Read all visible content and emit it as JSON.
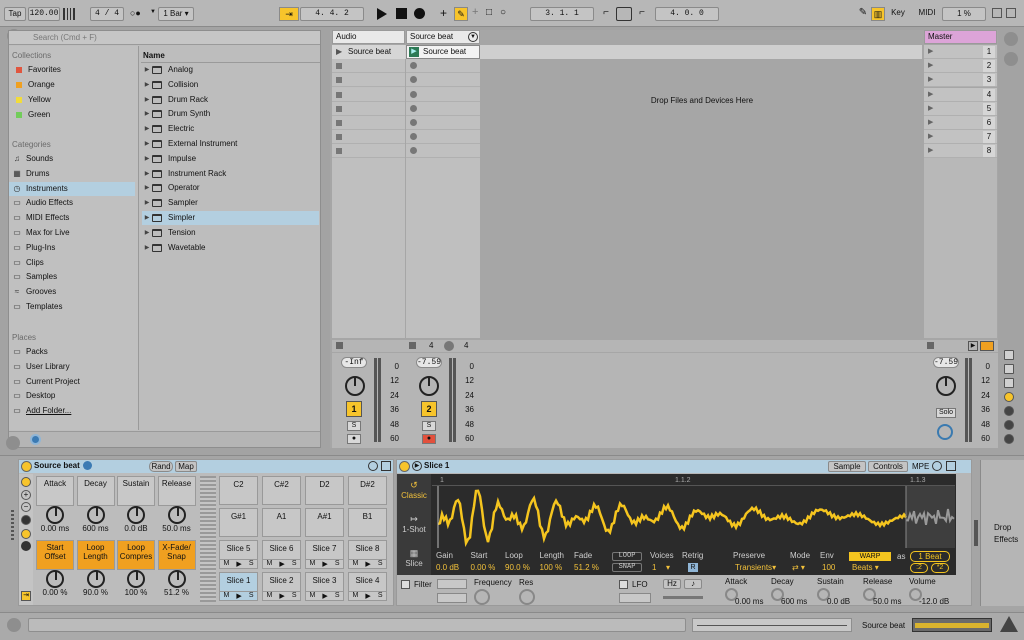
{
  "transport": {
    "tap": "Tap",
    "tempo": "120.00",
    "signature_num": "4",
    "signature_slash": "/",
    "signature_den": "4",
    "quantize": "1 Bar",
    "position": "4.   4.   2",
    "loop_start": "3.   1.   1",
    "loop_length": "4.   0.   0",
    "key_label": "Key",
    "midi_label": "MIDI",
    "cpu": "1 %"
  },
  "browser": {
    "search_placeholder": "Search (Cmd + F)",
    "collections_header": "Collections",
    "collections": [
      {
        "label": "Favorites",
        "color": "#e0563f"
      },
      {
        "label": "Orange",
        "color": "#f0a020"
      },
      {
        "label": "Yellow",
        "color": "#f2dc3a"
      },
      {
        "label": "Green",
        "color": "#72cc5a"
      }
    ],
    "categories_header": "Categories",
    "categories": [
      {
        "label": "Sounds",
        "icon": "music-note-icon"
      },
      {
        "label": "Drums",
        "icon": "drum-grid-icon"
      },
      {
        "label": "Instruments",
        "icon": "clock-icon"
      },
      {
        "label": "Audio Effects",
        "icon": "audio-effects-icon"
      },
      {
        "label": "MIDI Effects",
        "icon": "midi-effects-icon"
      },
      {
        "label": "Max for Live",
        "icon": "max-icon"
      },
      {
        "label": "Plug-Ins",
        "icon": "plugin-icon"
      },
      {
        "label": "Clips",
        "icon": "clips-icon"
      },
      {
        "label": "Samples",
        "icon": "samples-icon"
      },
      {
        "label": "Grooves",
        "icon": "grooves-icon"
      },
      {
        "label": "Templates",
        "icon": "templates-icon"
      }
    ],
    "places_header": "Places",
    "places": [
      {
        "label": "Packs",
        "icon": "packs-icon"
      },
      {
        "label": "User Library",
        "icon": "library-icon"
      },
      {
        "label": "Current Project",
        "icon": "project-icon"
      },
      {
        "label": "Desktop",
        "icon": "desktop-icon"
      },
      {
        "label": "Add Folder...",
        "icon": "add-folder-icon"
      }
    ],
    "name_header": "Name",
    "items": [
      "Analog",
      "Collision",
      "Drum Rack",
      "Drum Synth",
      "Electric",
      "External Instrument",
      "Impulse",
      "Instrument Rack",
      "Operator",
      "Sampler",
      "Simpler",
      "Tension",
      "Wavetable"
    ],
    "selected_item": "Simpler",
    "selected_category": "Instruments"
  },
  "session": {
    "tracks": [
      {
        "name": "Audio",
        "clip": "Source beat",
        "volume": "-Inf",
        "number": "1",
        "solo": "S"
      },
      {
        "name": "Source beat",
        "clip": "Source beat",
        "volume": "-7.59",
        "number": "2",
        "solo": "S",
        "in": "4",
        "out": "4"
      }
    ],
    "drop_text": "Drop Files and Devices Here",
    "master": {
      "name": "Master",
      "scenes": [
        "1",
        "2",
        "3",
        "4",
        "5",
        "6",
        "7",
        "8"
      ],
      "volume": "-7.59",
      "solo": "Solo"
    },
    "meter_scale": [
      "0",
      "12",
      "24",
      "36",
      "48",
      "60"
    ]
  },
  "drumrack": {
    "title": "Source beat",
    "rand": "Rand",
    "map": "Map",
    "macros_top": [
      {
        "label": "Attack",
        "value": "0.00 ms"
      },
      {
        "label": "Decay",
        "value": "600 ms"
      },
      {
        "label": "Sustain",
        "value": "0.0 dB"
      },
      {
        "label": "Release",
        "value": "50.0 ms"
      }
    ],
    "macros_bottom": [
      {
        "label": "Start Offset",
        "value": "0.00 %"
      },
      {
        "label": "Loop Length",
        "value": "90.0 %"
      },
      {
        "label": "Loop Compres",
        "value": "100 %"
      },
      {
        "label": "X-Fade/ Snap",
        "value": "51.2 %"
      }
    ],
    "pads_row1": [
      "C2",
      "C#2",
      "D2",
      "D#2"
    ],
    "pads_row2": [
      "G#1",
      "A1",
      "A#1",
      "B1"
    ],
    "pads_row3": [
      "Slice 5",
      "Slice 6",
      "Slice 7",
      "Slice 8"
    ],
    "pads_row4": [
      "Slice 1",
      "Slice 2",
      "Slice 3",
      "Slice 4"
    ],
    "pad_buttons": [
      "M",
      "▶",
      "S"
    ]
  },
  "simpler": {
    "title": "Slice 1",
    "tabs": [
      "Sample",
      "Controls",
      "MPE"
    ],
    "modes": [
      "Classic",
      "1-Shot",
      "Slice"
    ],
    "markers": [
      "1",
      "1.1.2",
      "1.1.3"
    ],
    "params": [
      {
        "label": "Gain",
        "value": "0.0 dB"
      },
      {
        "label": "Start",
        "value": "0.00 %"
      },
      {
        "label": "Loop",
        "value": "90.0 %"
      },
      {
        "label": "Length",
        "value": "100 %"
      },
      {
        "label": "Fade",
        "value": "51.2 %"
      }
    ],
    "loop_btn": "LOOP",
    "snap_btn": "SNAP",
    "voices_label": "Voices",
    "voices_value": "1",
    "retrig_label": "Retrig",
    "retrig_value": "R",
    "preserve_label": "Preserve",
    "preserve_value": "Transients",
    "mode_label": "Mode",
    "env_label": "Env",
    "env_value": "100",
    "warp": "WARP",
    "warp_as": "as",
    "beats_value": "1 Beat",
    "beats_mode": "Beats",
    "div2": ":2",
    "mul2": "*2",
    "filter_label": "Filter",
    "freq_label": "Frequency",
    "res_label": "Res",
    "lfo_label": "LFO",
    "hz": "Hz",
    "env_params": [
      {
        "label": "Attack",
        "value": "0.00 ms"
      },
      {
        "label": "Decay",
        "value": "600 ms"
      },
      {
        "label": "Sustain",
        "value": "0.0 dB"
      },
      {
        "label": "Release",
        "value": "50.0 ms"
      },
      {
        "label": "Volume",
        "value": "-12.0 dB"
      }
    ]
  },
  "rightpanel": {
    "text": "Drop Effects"
  },
  "statusbar": {
    "track": "Source beat"
  },
  "colors": {
    "accent": "#f7c42b",
    "waveform": "#f5c51f",
    "selection": "#b3cfe0",
    "orange": "#f0a020"
  }
}
